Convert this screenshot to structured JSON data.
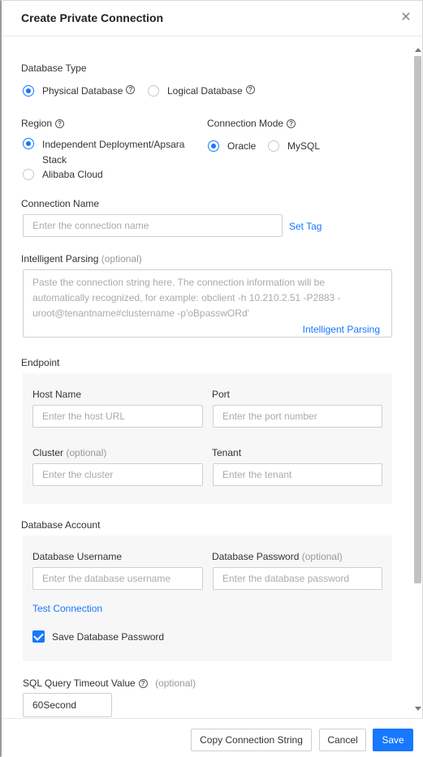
{
  "dialog": {
    "title": "Create Private Connection",
    "close_symbol": "✕"
  },
  "database_type": {
    "label": "Database Type",
    "options": [
      "Physical Database",
      "Logical Database"
    ],
    "selected": "Physical Database"
  },
  "region": {
    "label": "Region",
    "options": [
      "Independent Deployment/Apsara Stack",
      "Alibaba Cloud"
    ],
    "selected": "Independent Deployment/Apsara Stack"
  },
  "connection_mode": {
    "label": "Connection Mode",
    "options": [
      "Oracle",
      "MySQL"
    ],
    "selected": "Oracle"
  },
  "connection_name": {
    "label": "Connection Name",
    "placeholder": "Enter the connection name",
    "value": "",
    "set_tag": "Set Tag"
  },
  "intelligent_parsing": {
    "label": "Intelligent Parsing",
    "optional": "(optional)",
    "placeholder": "Paste the connection string here. The connection information will be automatically recognized, for example: obclient -h 10.210.2.51 -P2883 -uroot@tenantname#clustername -p'oBpasswORd'",
    "action": "Intelligent Parsing"
  },
  "endpoint": {
    "label": "Endpoint",
    "host": {
      "label": "Host Name",
      "placeholder": "Enter the host URL"
    },
    "port": {
      "label": "Port",
      "placeholder": "Enter the port number"
    },
    "cluster": {
      "label": "Cluster",
      "optional": "(optional)",
      "placeholder": "Enter the cluster"
    },
    "tenant": {
      "label": "Tenant",
      "placeholder": "Enter the tenant"
    }
  },
  "account": {
    "label": "Database Account",
    "username": {
      "label": "Database Username",
      "placeholder": "Enter the database username"
    },
    "password": {
      "label": "Database Password",
      "optional": "(optional)",
      "placeholder": "Enter the database password"
    },
    "test_connection": "Test Connection",
    "save_password": {
      "label": "Save Database Password",
      "checked": true
    }
  },
  "timeout": {
    "label": "SQL Query Timeout Value",
    "optional": "(optional)",
    "value": "60Second"
  },
  "footer": {
    "copy": "Copy Connection String",
    "cancel": "Cancel",
    "save": "Save"
  },
  "colors": {
    "accent": "#1677ff",
    "panel": "#f7f7f7",
    "border": "#d0d0d0"
  },
  "icons": {
    "help": "question-circle-icon",
    "close": "close-icon",
    "check": "checkmark-icon"
  }
}
